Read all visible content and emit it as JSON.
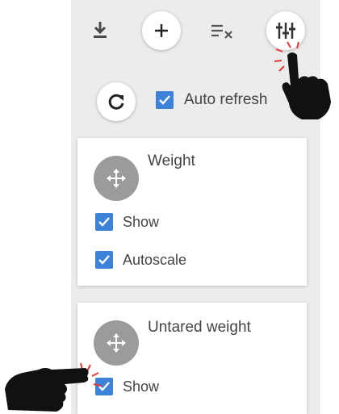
{
  "toolbar": {
    "download_icon": "download-icon",
    "add_icon": "plus-icon",
    "clear_icon": "clear-list-icon",
    "settings_icon": "sliders-icon"
  },
  "refresh": {
    "icon": "refresh-icon",
    "auto_refresh_label": "Auto refresh",
    "auto_refresh_checked": true
  },
  "cards": [
    {
      "title": "Weight",
      "show_label": "Show",
      "show_checked": true,
      "autoscale_label": "Autoscale",
      "autoscale_checked": true
    },
    {
      "title": "Untared weight",
      "show_label": "Show",
      "show_checked": true
    }
  ],
  "colors": {
    "checkbox": "#3b82d8",
    "panel": "#ececec",
    "move_circle": "#9b9b9b",
    "click_mark": "#e53935"
  }
}
